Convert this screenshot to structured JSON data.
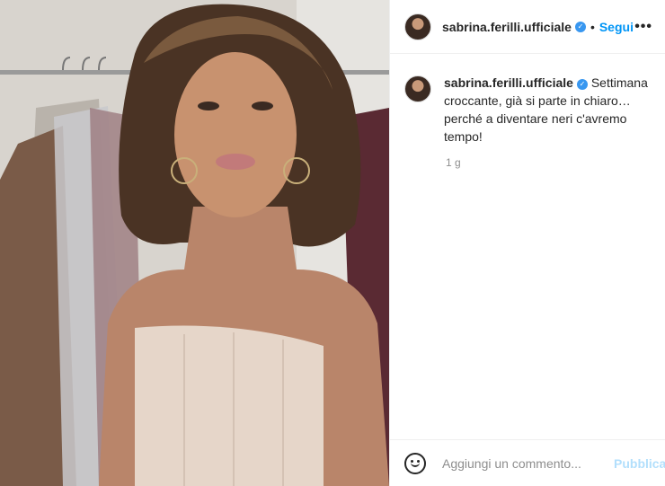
{
  "post": {
    "username": "sabrina.ferilli.ufficiale",
    "follow_label": "Segui",
    "separator": "•",
    "more_label": "•••",
    "verified_mark": "✓",
    "caption": "Settimana croccante, già si parte in chiaro… perché a diventare neri c'avremo tempo!",
    "time_ago": "1 g",
    "comment_placeholder": "Aggiungi un commento...",
    "publish_label": "Pubblica"
  },
  "icons": {
    "verified": "verified-badge-icon",
    "more": "more-options-icon",
    "emoji": "emoji-icon"
  },
  "colors": {
    "link_blue": "#0095f6",
    "verified_blue": "#3897f0",
    "publish_disabled": "#b2dffc",
    "muted": "#8e8e8e"
  }
}
